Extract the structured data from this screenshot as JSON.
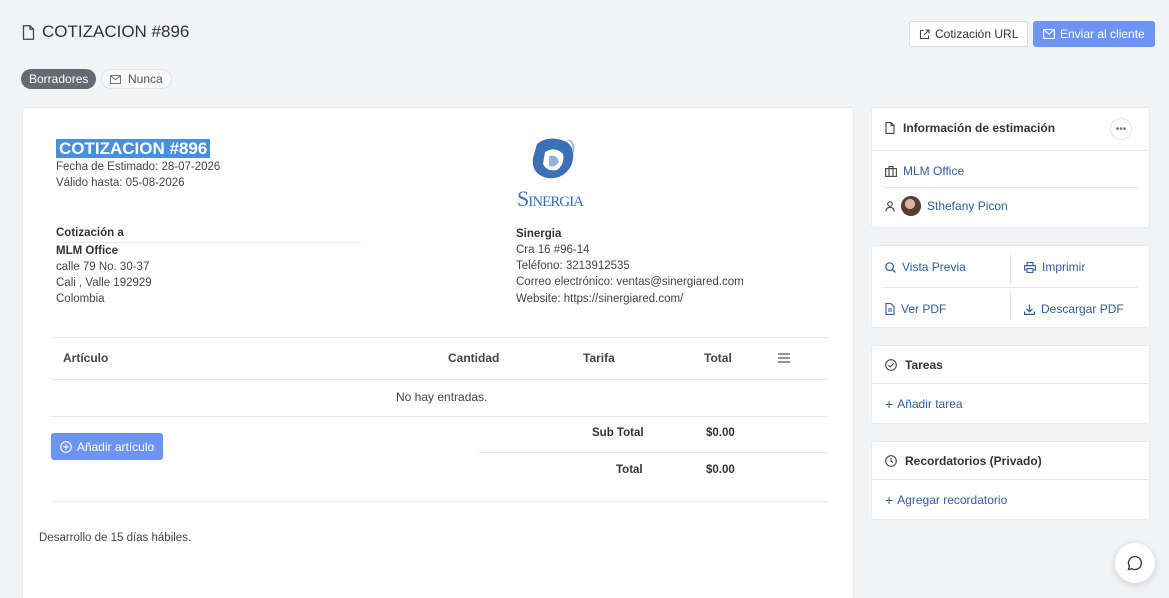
{
  "header": {
    "title": "COTIZACION #896",
    "url_button": "Cotización URL",
    "send_button": "Enviar al cliente"
  },
  "tags": {
    "status": "Borradores",
    "email_status": "Nunca"
  },
  "estimate": {
    "title": "COTIZACION #896",
    "estimated_date": "Fecha de Estimado: 28-07-2026",
    "valid_until": "Válido hasta: 05-08-2026",
    "to_label": "Cotización a",
    "client": {
      "name": "MLM Office",
      "address": "calle 79 No. 30-37",
      "city": "Cali , Valle 192929",
      "country": "Colombia"
    },
    "company": {
      "logo_text": "SINERGIA",
      "name": "Sinergia",
      "address": "Cra 16 #96-14",
      "phone": "Teléfono: 3213912535",
      "email": "Correo electrónico: ventas@sinergiared.com",
      "website": "Website: https://sinergiared.com/"
    },
    "table": {
      "columns": [
        "Artículo",
        "Cantidad",
        "Tarifa",
        "Total"
      ],
      "empty_text": "No hay entradas."
    },
    "add_item_button": "Añadir artículo",
    "subtotal_label": "Sub Total",
    "subtotal_value": "$0.00",
    "total_label": "Total",
    "total_value": "$0.00",
    "note": "Desarrollo de 15 días hábiles."
  },
  "sidebar": {
    "info": {
      "title": "Información de estimación",
      "client": "MLM Office",
      "user": "Sthefany Picon"
    },
    "actions": {
      "preview": "Vista Previa",
      "print": "Imprimir",
      "view_pdf": "Ver PDF",
      "download_pdf": "Descargar PDF"
    },
    "tasks": {
      "title": "Tareas",
      "add": "Añadir tarea"
    },
    "reminders": {
      "title": "Recordatorios (Privado)",
      "add": "Agregar recordatorio"
    }
  },
  "colors": {
    "primary": "#6c94f0",
    "highlight": "#4a90d9",
    "link": "#2e5e9e",
    "status_pill": "#646b73"
  }
}
